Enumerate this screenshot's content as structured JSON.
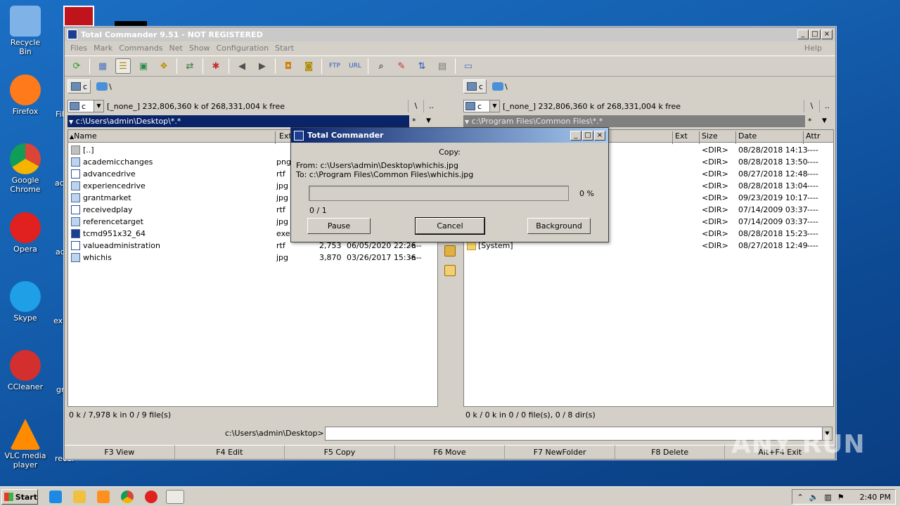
{
  "desktop": {
    "icons": [
      {
        "label": "Recycle Bin",
        "color": "#7fb3e8"
      },
      {
        "label": "Firefox",
        "color": "#ff7a1a"
      },
      {
        "label": "Google Chrome",
        "color": "#4caf50"
      },
      {
        "label": "Opera",
        "color": "#e0211f"
      },
      {
        "label": "Skype",
        "color": "#1e9fe6"
      },
      {
        "label": "CCleaner",
        "color": "#d32f2f"
      },
      {
        "label": "VLC media player",
        "color": "#ff8c00"
      }
    ],
    "peek_labels": [
      "Fil",
      "aca",
      "ad",
      "exp",
      "gr",
      "recei"
    ]
  },
  "window": {
    "title": "Total Commander 9.51 - NOT REGISTERED",
    "menu": [
      "Files",
      "Mark",
      "Commands",
      "Net",
      "Show",
      "Configuration",
      "Start"
    ],
    "help": "Help",
    "left": {
      "drive": "c",
      "net_path": "\\",
      "free_text": "[_none_]  232,806,360 k of 268,331,004 k free",
      "root_btn": "\\",
      "up_btn": "..",
      "path": "c:\\Users\\admin\\Desktop\\*.*",
      "star_btn": "*",
      "columns": [
        "Name",
        "Ext"
      ],
      "rows": [
        {
          "name": "[..]",
          "ext": "",
          "size": "",
          "date": "",
          "attr": "",
          "icon": "up"
        },
        {
          "name": "academicchanges",
          "ext": "png",
          "size": "",
          "date": "",
          "attr": "",
          "icon": "img"
        },
        {
          "name": "advancedrive",
          "ext": "rtf",
          "size": "",
          "date": "",
          "attr": "",
          "icon": "doc"
        },
        {
          "name": "experiencedrive",
          "ext": "jpg",
          "size": "",
          "date": "",
          "attr": "",
          "icon": "img"
        },
        {
          "name": "grantmarket",
          "ext": "jpg",
          "size": "",
          "date": "",
          "attr": "",
          "icon": "img"
        },
        {
          "name": "receivedplay",
          "ext": "rtf",
          "size": "",
          "date": "",
          "attr": "",
          "icon": "doc"
        },
        {
          "name": "referencetarget",
          "ext": "jpg",
          "size": "",
          "date": "",
          "attr": "",
          "icon": "img"
        },
        {
          "name": "tcmd951x32_64",
          "ext": "exe",
          "size": "",
          "date": "",
          "attr": "",
          "icon": "exe"
        },
        {
          "name": "valueadministration",
          "ext": "rtf",
          "size": "2,753",
          "date": "06/05/2020 22:26",
          "attr": "-a--",
          "icon": "doc"
        },
        {
          "name": "whichis",
          "ext": "jpg",
          "size": "3,870",
          "date": "03/26/2017 15:36",
          "attr": "-a--",
          "icon": "img"
        }
      ],
      "status": "0 k / 7,978 k in 0 / 9 file(s)"
    },
    "right": {
      "drive": "c",
      "net_path": "\\",
      "free_text": "[_none_]  232,806,360 k of 268,331,004 k free",
      "root_btn": "\\",
      "up_btn": "..",
      "path": "c:\\Program Files\\Common Files\\*.*",
      "star_btn": "*",
      "columns": [
        "Ext",
        "Size",
        "Date",
        "Attr"
      ],
      "rows": [
        {
          "name": "",
          "size": "<DIR>",
          "date": "08/28/2018 14:13",
          "attr": "----"
        },
        {
          "name": "",
          "size": "<DIR>",
          "date": "08/28/2018 13:50",
          "attr": "----"
        },
        {
          "name": "",
          "size": "<DIR>",
          "date": "08/27/2018 12:48",
          "attr": "----"
        },
        {
          "name": "",
          "size": "<DIR>",
          "date": "08/28/2018 13:04",
          "attr": "----"
        },
        {
          "name": "",
          "size": "<DIR>",
          "date": "09/23/2019 10:17",
          "attr": "----"
        },
        {
          "name": "",
          "size": "<DIR>",
          "date": "07/14/2009 03:37",
          "attr": "----"
        },
        {
          "name": "",
          "size": "<DIR>",
          "date": "07/14/2009 03:37",
          "attr": "----"
        },
        {
          "name": "",
          "size": "<DIR>",
          "date": "08/28/2018 15:23",
          "attr": "----"
        },
        {
          "name": "[System]",
          "size": "<DIR>",
          "date": "08/27/2018 12:49",
          "attr": "----"
        }
      ],
      "status": "0 k / 0 k in 0 / 0 file(s), 0 / 8 dir(s)"
    },
    "cmd_label": "c:\\Users\\admin\\Desktop>",
    "fkeys": [
      "F3 View",
      "F4 Edit",
      "F5 Copy",
      "F6 Move",
      "F7 NewFolder",
      "F8 Delete",
      "Alt+F4 Exit"
    ]
  },
  "dialog": {
    "title": "Total Commander",
    "heading": "Copy:",
    "from": "From: c:\\Users\\admin\\Desktop\\whichis.jpg",
    "to": "To:  c:\\Program Files\\Common Files\\whichis.jpg",
    "progress_percent": 0,
    "progress_label": "0 %",
    "count": "0 / 1",
    "buttons": {
      "pause": "Pause",
      "cancel": "Cancel",
      "background": "Background"
    }
  },
  "taskbar": {
    "start": "Start",
    "clock": "2:40 PM"
  },
  "watermark": "ANY RUN"
}
